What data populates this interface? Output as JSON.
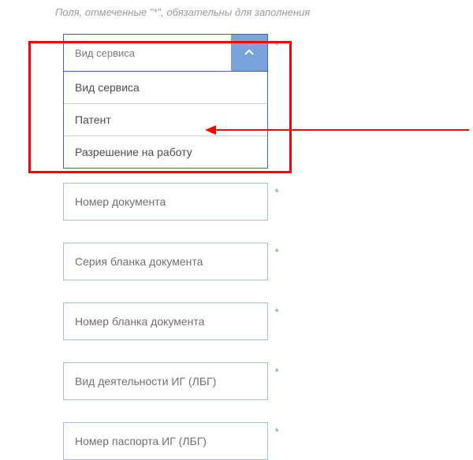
{
  "note": "Поля, отмеченные \"*\", обязательны для заполнения",
  "dropdown": {
    "head_label": "Вид сервиса",
    "options": [
      "Вид сервиса",
      "Патент",
      "Разрешение на работу"
    ]
  },
  "fields": {
    "doc_number": "Номер документа",
    "blank_series": "Серия бланка документа",
    "blank_number": "Номер бланка документа",
    "activity_type": "Вид деятельности ИГ (ЛБГ)",
    "passport_number": "Номер паспорта ИГ (ЛБГ)"
  },
  "required_mark": "*"
}
